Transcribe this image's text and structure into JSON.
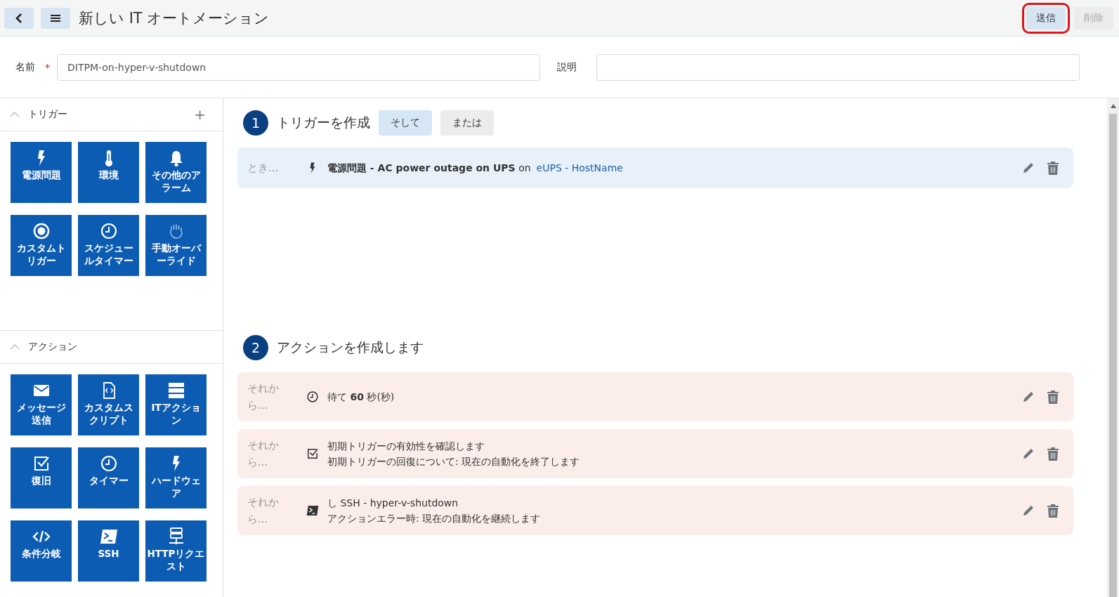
{
  "header": {
    "title": "新しい IT オートメーション",
    "buttons": [
      {
        "label": "送信",
        "disabled": false,
        "highlighted": true
      },
      {
        "label": "削除",
        "disabled": true,
        "highlighted": false
      }
    ]
  },
  "form": {
    "name_label": "名前",
    "required_mark": "*",
    "name_value": "DITPM-on-hyper-v-shutdown",
    "description_label": "説明"
  },
  "sidebar": {
    "sections": [
      {
        "title": "トリガー",
        "expanded": true,
        "add": "+",
        "tiles": [
          {
            "label": "電源問題",
            "kind": "bolt"
          },
          {
            "label": "環境",
            "kind": "thermometer"
          },
          {
            "label": "その他のアラーム",
            "kind": "bell"
          },
          {
            "label": "カスタムトリガー",
            "kind": "target"
          },
          {
            "label": "スケジュールタイマー",
            "kind": "clock"
          },
          {
            "label": "手動オーバーライド",
            "kind": "hand"
          }
        ]
      },
      {
        "title": "アクション",
        "expanded": true,
        "tiles": [
          {
            "label": "メッセージ送信",
            "kind": "mail"
          },
          {
            "label": "カスタムスクリプト",
            "kind": "script"
          },
          {
            "label": "ITアクション",
            "kind": "stack"
          },
          {
            "label": "復旧",
            "kind": "check"
          },
          {
            "label": "タイマー",
            "kind": "clock"
          },
          {
            "label": "ハードウェア",
            "kind": "bolt"
          },
          {
            "label": "条件分岐",
            "kind": "code"
          },
          {
            "label": "SSH",
            "kind": "terminal"
          },
          {
            "label": "HTTPリクエスト",
            "kind": "server"
          }
        ]
      }
    ]
  },
  "steps": [
    {
      "number": "1",
      "title": "トリガーを作成",
      "operators": [
        {
          "label": "そして",
          "selected": true
        },
        {
          "label": "または",
          "selected": false
        }
      ],
      "rows": [
        {
          "prefix": "とき...",
          "kind": "bolt",
          "lines": [
            "**電源問題 - AC power outage on UPS** on"
          ],
          "link": "eUPS - HostName"
        }
      ]
    },
    {
      "number": "2",
      "title": "アクションを作成します",
      "rows": [
        {
          "prefix": "それから...",
          "kind": "clock",
          "lines": [
            "待て **60** 秒(秒)"
          ]
        },
        {
          "prefix": "それから...",
          "kind": "check",
          "lines": [
            "初期トリガーの有効性を確認します",
            "初期トリガーの回復について: 現在の自動化を終了します"
          ]
        },
        {
          "prefix": "それから...",
          "kind": "terminal",
          "lines": [
            "し SSH - hyper-v-shutdown",
            "アクションエラー時: 現在の自動化を継続します"
          ]
        }
      ]
    }
  ]
}
